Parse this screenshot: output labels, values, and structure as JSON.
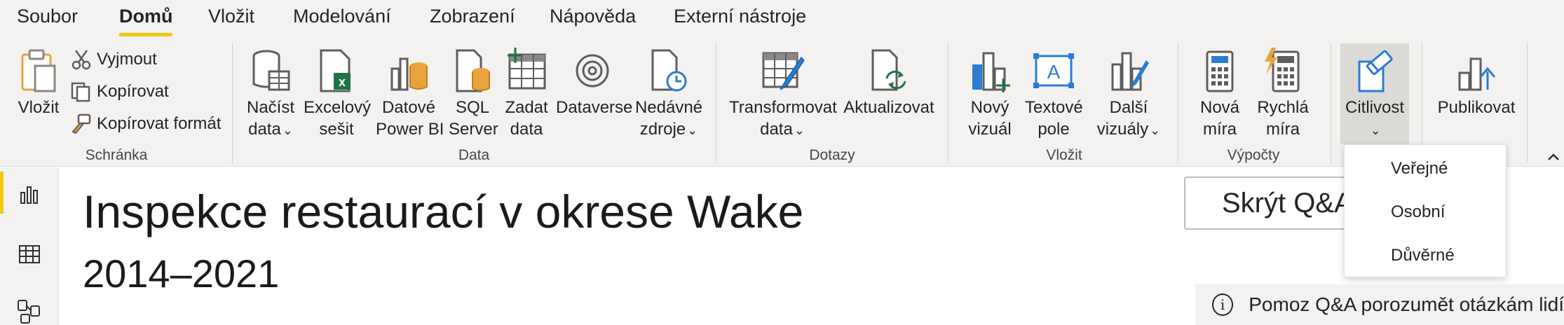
{
  "menu": {
    "items": [
      "Soubor",
      "Domů",
      "Vložit",
      "Modelování",
      "Zobrazení",
      "Nápověda",
      "Externí nástroje"
    ],
    "active_index": 1
  },
  "ribbon": {
    "clipboard": {
      "paste": "Vložit",
      "cut": "Vyjmout",
      "copy": "Kopírovat",
      "format_painter": "Kopírovat formát",
      "group_label": "Schránka"
    },
    "data": {
      "get_data": [
        "Načíst",
        "data"
      ],
      "excel": [
        "Excelový",
        "sešit"
      ],
      "pbi_datasets": [
        "Datové",
        "Power BI"
      ],
      "sql": [
        "SQL",
        "Server"
      ],
      "enter_data": [
        "Zadat",
        "data"
      ],
      "dataverse": "Dataverse",
      "recent": [
        "Nedávné",
        "zdroje"
      ],
      "group_label": "Data"
    },
    "queries": {
      "transform": [
        "Transformovat",
        "data"
      ],
      "refresh": "Aktualizovat",
      "group_label": "Dotazy"
    },
    "insert": {
      "new_visual": [
        "Nový",
        "vizuál"
      ],
      "text_box": [
        "Textové",
        "pole"
      ],
      "more_visuals": [
        "Další",
        "vizuály"
      ],
      "group_label": "Vložit"
    },
    "calculations": {
      "new_measure": [
        "Nová",
        "míra"
      ],
      "quick_measure": [
        "Rychlá",
        "míra"
      ],
      "group_label": "Výpočty"
    },
    "sensitivity": {
      "label": "Citlivost"
    },
    "share": {
      "publish": "Publikovat"
    },
    "chevron": "⌄",
    "collapse_icon": "chevron-up-icon"
  },
  "sensitivity_dropdown": {
    "options": [
      "Veřejné",
      "Osobní",
      "Důvěrné"
    ]
  },
  "rail": {
    "items": [
      "report-view-icon",
      "table-view-icon",
      "model-view-icon"
    ],
    "active_index": 0
  },
  "canvas": {
    "title": "Inspekce restaurací v okrese Wake",
    "subtitle": "2014–2021",
    "qa_button": "Skrýt Q&A",
    "qa_help": "Pomoz Q&A porozumět otázkám lidí"
  },
  "colors": {
    "accent": "#f2c811",
    "ribbon_bg": "#f3f2f1",
    "excel_green": "#217346",
    "icon_blue": "#2b7cd3",
    "db_orange": "#e8a33c"
  }
}
